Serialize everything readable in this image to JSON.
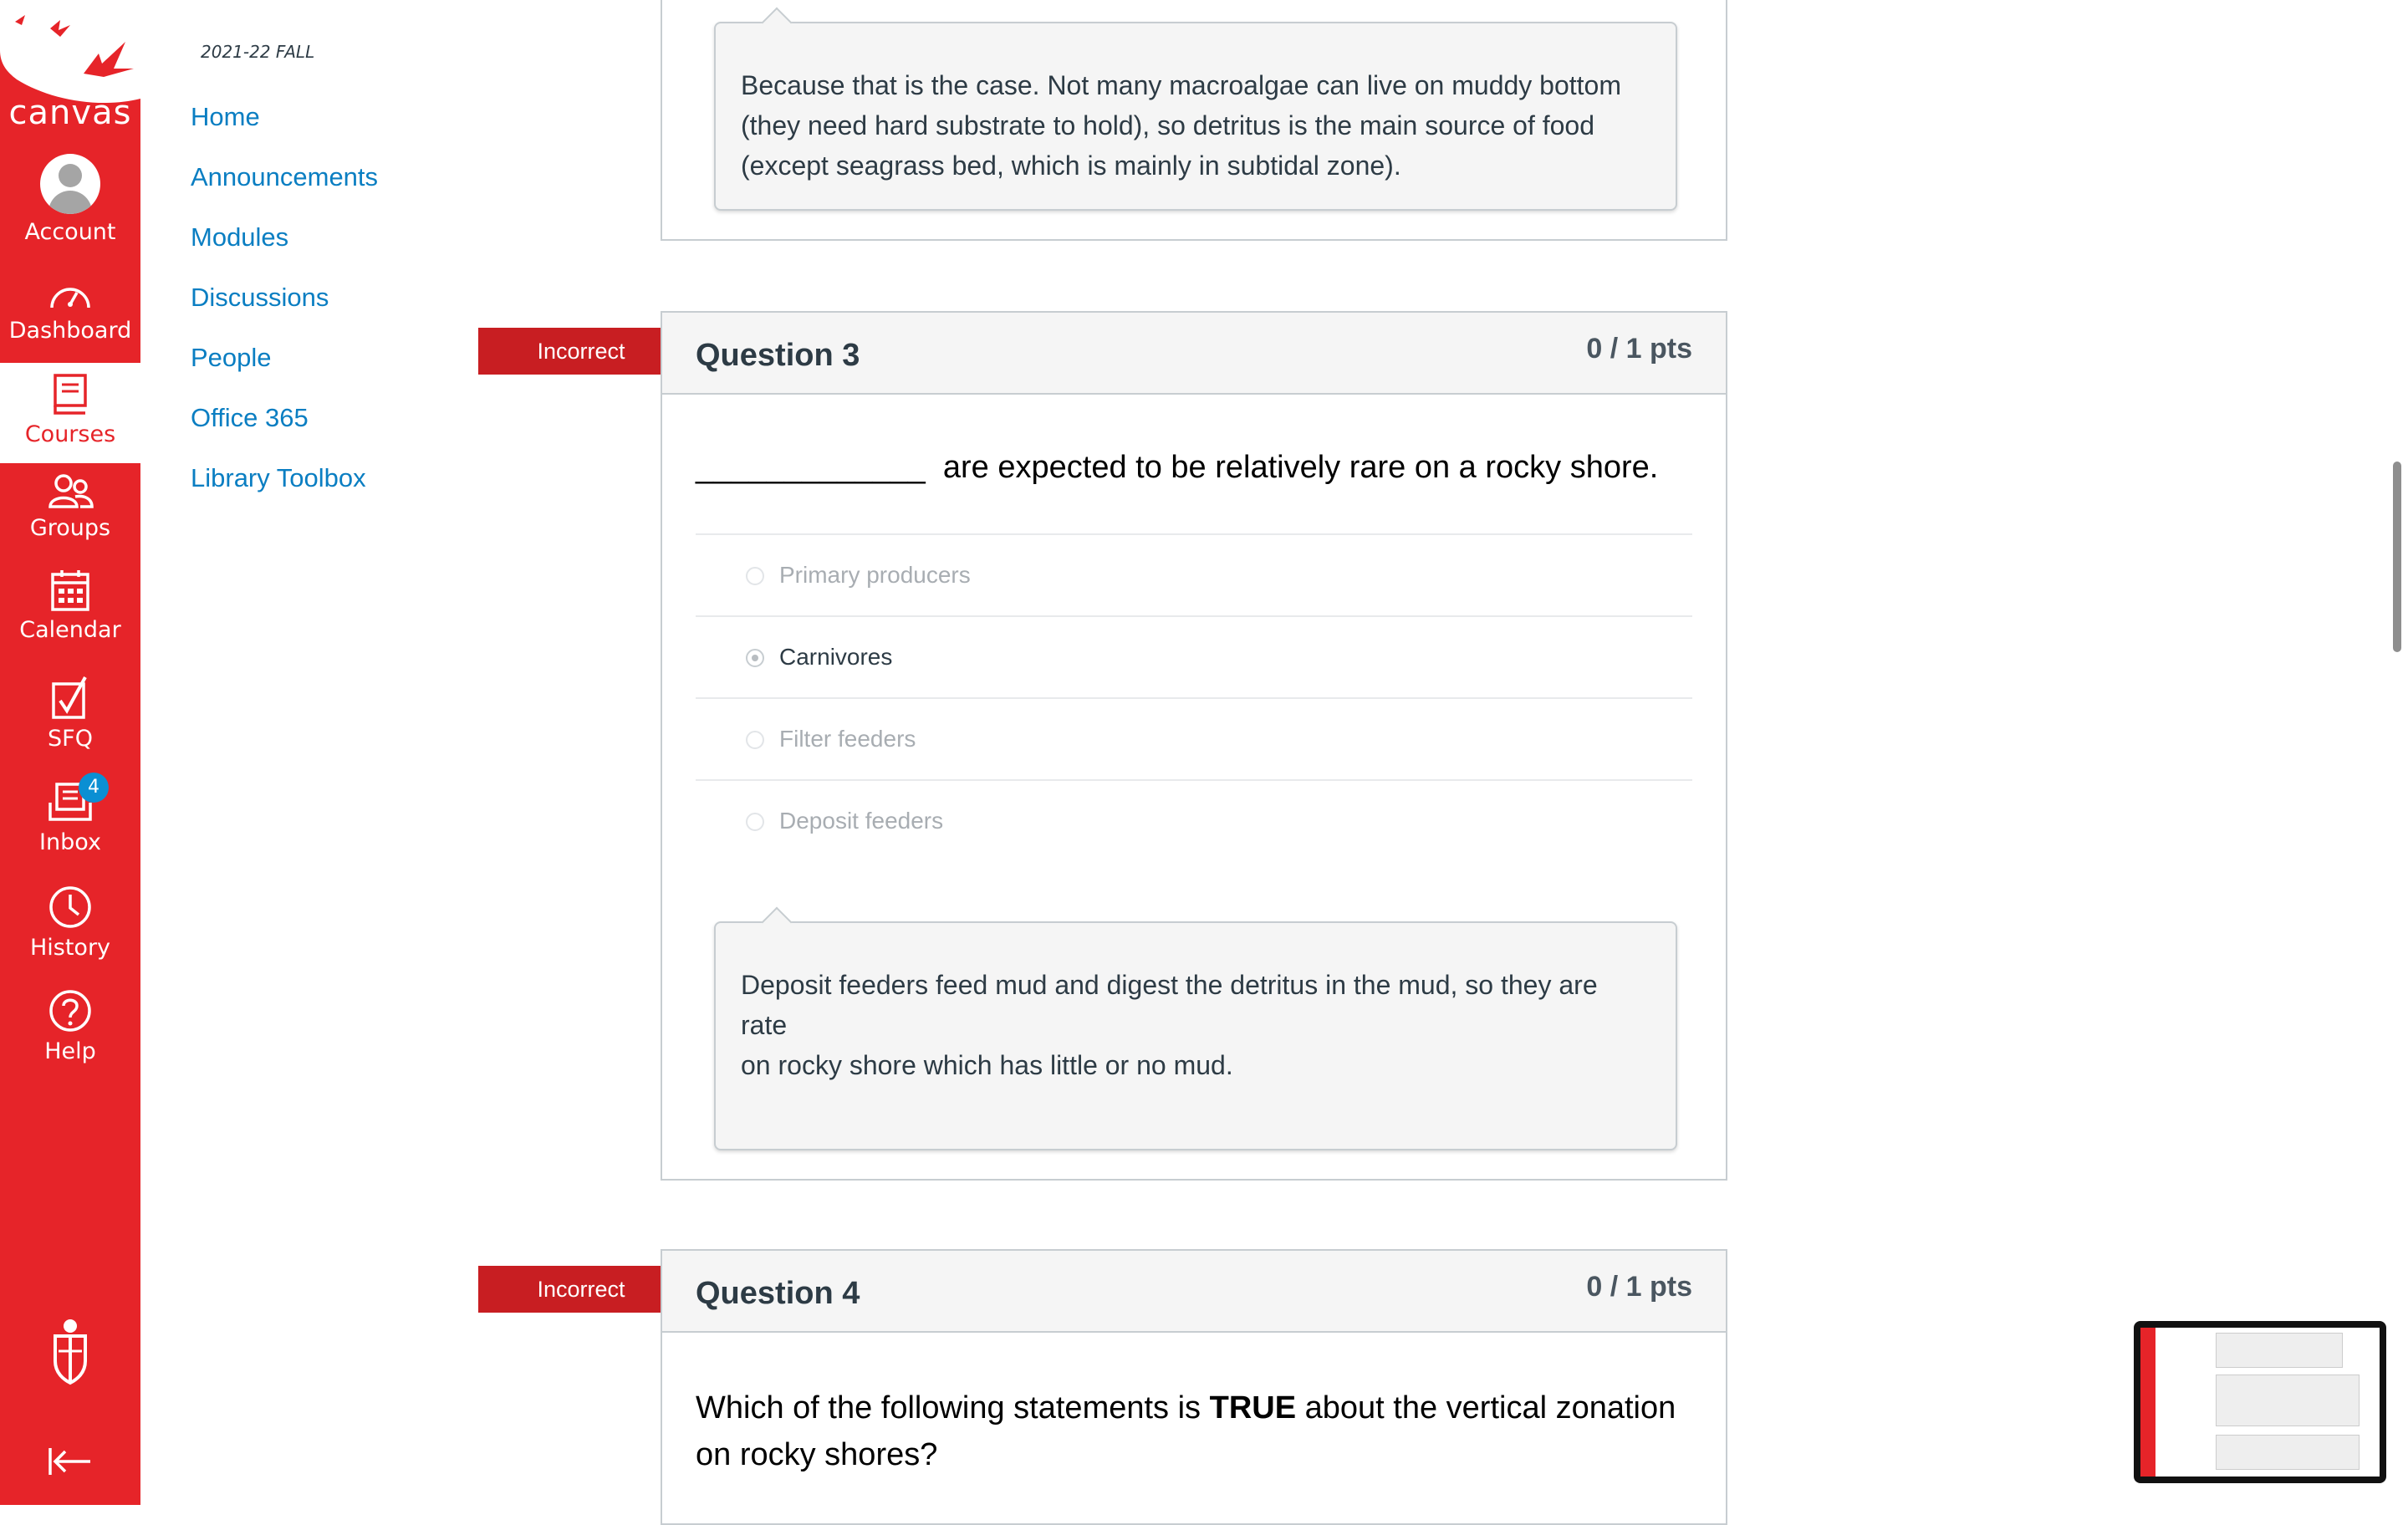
{
  "global_nav": {
    "logo_text": "canvas",
    "items": [
      {
        "label": "Account"
      },
      {
        "label": "Dashboard"
      },
      {
        "label": "Courses"
      },
      {
        "label": "Groups"
      },
      {
        "label": "Calendar"
      },
      {
        "label": "SFQ"
      },
      {
        "label": "Inbox",
        "badge": "4"
      },
      {
        "label": "History"
      },
      {
        "label": "Help"
      }
    ],
    "accent": "#e62429",
    "badge_color": "#0b8fd3"
  },
  "course_nav": {
    "term": "2021-22 FALL",
    "links": [
      "Home",
      "Announcements",
      "Modules",
      "Discussions",
      "People",
      "Office 365",
      "Library Toolbox"
    ],
    "link_color": "#0a7ec2"
  },
  "prev_comment": {
    "lines": [
      "Because that is the case. Not many macroalgae can live on muddy bottom",
      "(they need hard substrate to hold), so detritus is the main source of food",
      "(except seagrass bed, which is mainly in subtidal zone)."
    ]
  },
  "q3": {
    "flag": "Incorrect",
    "title": "Question 3",
    "points": "0 / 1 pts",
    "blank": "_____________",
    "text": "are expected to be relatively rare on a rocky shore.",
    "answers": [
      "Primary producers",
      "Carnivores",
      "Filter feeders",
      "Deposit feeders"
    ],
    "selected": "Carnivores",
    "comment_lines": [
      "Deposit feeders feed mud and digest the detritus in the mud, so they are rate",
      "on rocky shore which has little or no mud."
    ]
  },
  "q4": {
    "flag": "Incorrect",
    "title": "Question 4",
    "points": "0 / 1 pts",
    "text_before": "Which of the following statements is ",
    "text_bold": "TRUE",
    "text_after": " about the vertical zonation",
    "text_line2": "on rocky shores?"
  },
  "flag_color": "#c81e22"
}
